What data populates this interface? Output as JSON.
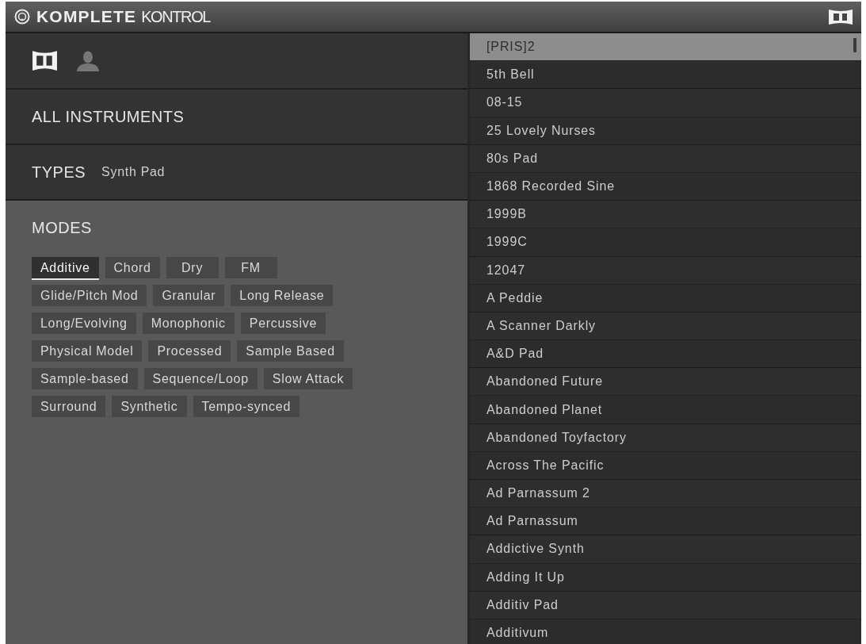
{
  "title_bar": {
    "brand_bold": "KOMPLETE",
    "brand_light": "KONTROL"
  },
  "library_tabs": [
    {
      "kind": "factory",
      "selected": true
    },
    {
      "kind": "user",
      "selected": false
    }
  ],
  "all_instruments": {
    "label": "ALL INSTRUMENTS"
  },
  "types": {
    "label": "TYPES",
    "value": "Synth Pad"
  },
  "modes": {
    "label": "MODES",
    "tags": [
      {
        "label": "Additive",
        "selected": true
      },
      {
        "label": "Chord",
        "selected": false
      },
      {
        "label": "Dry",
        "selected": false
      },
      {
        "label": "FM",
        "selected": false
      },
      {
        "label": "Glide/Pitch Mod",
        "selected": false
      },
      {
        "label": "Granular",
        "selected": false
      },
      {
        "label": "Long Release",
        "selected": false
      },
      {
        "label": "Long/Evolving",
        "selected": false
      },
      {
        "label": "Monophonic",
        "selected": false
      },
      {
        "label": "Percussive",
        "selected": false
      },
      {
        "label": "Physical Model",
        "selected": false
      },
      {
        "label": "Processed",
        "selected": false
      },
      {
        "label": "Sample Based",
        "selected": false
      },
      {
        "label": "Sample-based",
        "selected": false
      },
      {
        "label": "Sequence/Loop",
        "selected": false
      },
      {
        "label": "Slow Attack",
        "selected": false
      },
      {
        "label": "Surround",
        "selected": false
      },
      {
        "label": "Synthetic",
        "selected": false
      },
      {
        "label": "Tempo-synced",
        "selected": false
      }
    ]
  },
  "results": {
    "items": [
      {
        "label": "[PRIS]2",
        "selected": true
      },
      {
        "label": "5th Bell",
        "selected": false
      },
      {
        "label": "08-15",
        "selected": false
      },
      {
        "label": "25 Lovely Nurses",
        "selected": false
      },
      {
        "label": "80s Pad",
        "selected": false
      },
      {
        "label": "1868 Recorded Sine",
        "selected": false
      },
      {
        "label": "1999B",
        "selected": false
      },
      {
        "label": "1999C",
        "selected": false
      },
      {
        "label": "12047",
        "selected": false
      },
      {
        "label": "A Peddie",
        "selected": false
      },
      {
        "label": "A Scanner Darkly",
        "selected": false
      },
      {
        "label": "A&D Pad",
        "selected": false
      },
      {
        "label": "Abandoned Future",
        "selected": false
      },
      {
        "label": "Abandoned Planet",
        "selected": false
      },
      {
        "label": "Abandoned Toyfactory",
        "selected": false
      },
      {
        "label": "Across The Pacific",
        "selected": false
      },
      {
        "label": "Ad Parnassum 2",
        "selected": false
      },
      {
        "label": "Ad Parnassum",
        "selected": false
      },
      {
        "label": "Addictive Synth",
        "selected": false
      },
      {
        "label": "Adding It Up",
        "selected": false
      },
      {
        "label": "Additiv Pad",
        "selected": false
      },
      {
        "label": "Additivum",
        "selected": false
      }
    ]
  }
}
